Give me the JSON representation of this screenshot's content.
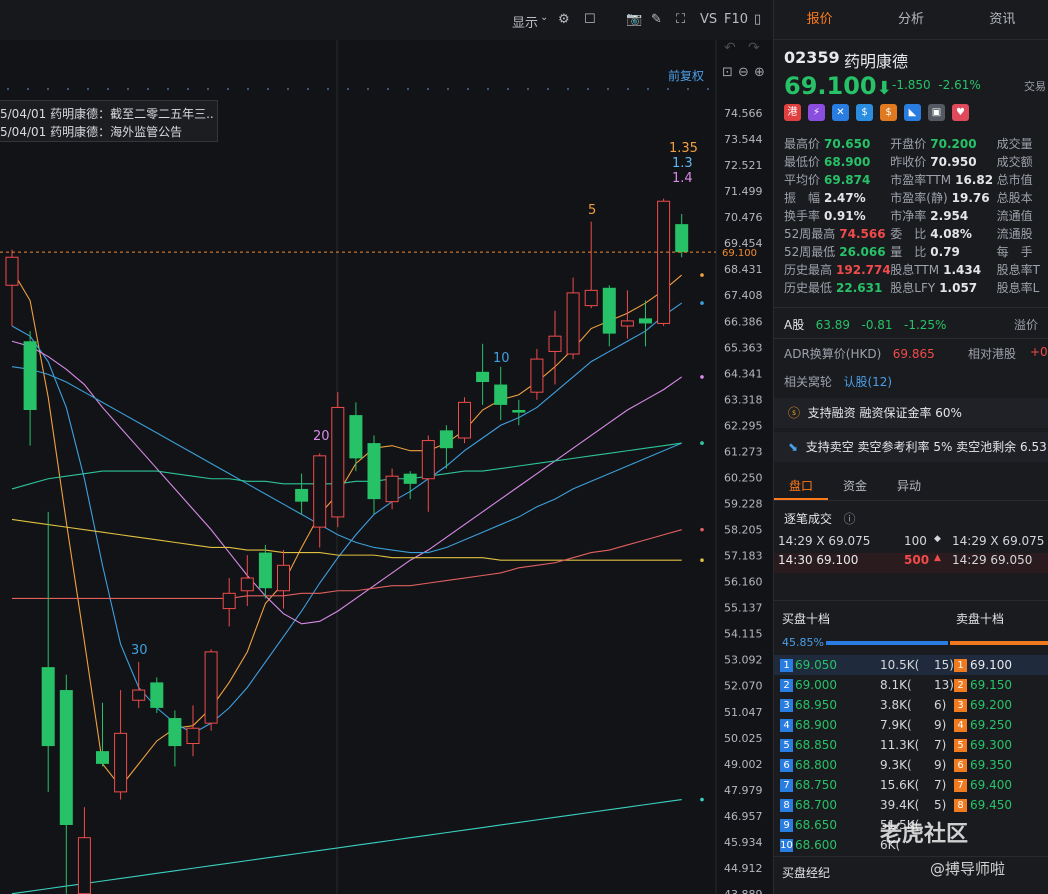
{
  "toolbar": {
    "display_label": "显示",
    "vs_label": "VS",
    "f10_label": "F10",
    "fuquan_label": "前复权"
  },
  "annotations": [
    "5/04/01  药明康德：截至二零二五年三...",
    "5/04/01  药明康德：海外监管公告"
  ],
  "chart_data": {
    "type": "candlestick",
    "y_ticks": [
      "74.566",
      "73.544",
      "72.521",
      "71.499",
      "70.476",
      "69.454",
      "68.431",
      "67.408",
      "66.386",
      "65.363",
      "64.341",
      "63.318",
      "62.295",
      "61.273",
      "60.250",
      "59.228",
      "58.205",
      "57.183",
      "56.160",
      "55.137",
      "54.115",
      "53.092",
      "52.070",
      "51.047",
      "50.025",
      "49.002",
      "47.979",
      "46.957",
      "45.934",
      "44.912",
      "43.889"
    ],
    "ylim": [
      43.889,
      74.566
    ],
    "current_price_label": "69.100",
    "ma_labels": [
      {
        "text": "30",
        "color": "#3fa0e0"
      },
      {
        "text": "20",
        "color": "#d98be8"
      },
      {
        "text": "10",
        "color": "#3fa0e0"
      },
      {
        "text": "5",
        "color": "#f0a040"
      },
      {
        "text": "1.35",
        "color": "#f0a040"
      },
      {
        "text": "1.3",
        "color": "#5fb8f0"
      },
      {
        "text": "1.4",
        "color": "#d98be8"
      }
    ],
    "candles": [
      {
        "o": 67.8,
        "c": 68.9,
        "h": 69.2,
        "l": 66.2
      },
      {
        "o": 65.6,
        "c": 62.9,
        "h": 66.0,
        "l": 61.5
      },
      {
        "o": 52.8,
        "c": 49.7,
        "h": 58.9,
        "l": 47.9
      },
      {
        "o": 51.9,
        "c": 46.6,
        "h": 52.5,
        "l": 43.9
      },
      {
        "o": 43.9,
        "c": 46.1,
        "h": 47.3,
        "l": 43.9
      },
      {
        "o": 49.5,
        "c": 49.0,
        "h": 51.4,
        "l": 48.9
      },
      {
        "o": 47.9,
        "c": 50.2,
        "h": 51.9,
        "l": 47.6
      },
      {
        "o": 51.5,
        "c": 51.9,
        "h": 53.0,
        "l": 51.2
      },
      {
        "o": 52.2,
        "c": 51.2,
        "h": 52.4,
        "l": 51.0
      },
      {
        "o": 50.8,
        "c": 49.7,
        "h": 51.1,
        "l": 48.9
      },
      {
        "o": 49.8,
        "c": 50.4,
        "h": 51.3,
        "l": 49.3
      },
      {
        "o": 50.6,
        "c": 53.4,
        "h": 53.5,
        "l": 50.3
      },
      {
        "o": 55.1,
        "c": 55.7,
        "h": 56.3,
        "l": 54.4
      },
      {
        "o": 55.8,
        "c": 56.3,
        "h": 57.2,
        "l": 55.2
      },
      {
        "o": 57.3,
        "c": 55.9,
        "h": 57.6,
        "l": 55.5
      },
      {
        "o": 55.8,
        "c": 56.8,
        "h": 57.4,
        "l": 55.1
      },
      {
        "o": 59.8,
        "c": 59.3,
        "h": 60.4,
        "l": 58.8
      },
      {
        "o": 58.3,
        "c": 61.1,
        "h": 61.2,
        "l": 57.5
      },
      {
        "o": 58.7,
        "c": 63.0,
        "h": 63.6,
        "l": 58.3
      },
      {
        "o": 62.7,
        "c": 61.0,
        "h": 63.2,
        "l": 60.5
      },
      {
        "o": 61.6,
        "c": 59.4,
        "h": 61.9,
        "l": 58.8
      },
      {
        "o": 59.3,
        "c": 60.3,
        "h": 60.6,
        "l": 59.0
      },
      {
        "o": 60.4,
        "c": 60.0,
        "h": 60.5,
        "l": 59.4
      },
      {
        "o": 60.2,
        "c": 61.7,
        "h": 61.9,
        "l": 58.9
      },
      {
        "o": 62.1,
        "c": 61.4,
        "h": 62.3,
        "l": 60.6
      },
      {
        "o": 61.8,
        "c": 63.2,
        "h": 63.4,
        "l": 61.6
      },
      {
        "o": 64.4,
        "c": 64.0,
        "h": 65.5,
        "l": 63.1
      },
      {
        "o": 63.9,
        "c": 63.1,
        "h": 64.6,
        "l": 62.5
      },
      {
        "o": 62.9,
        "c": 62.8,
        "h": 63.3,
        "l": 62.3
      },
      {
        "o": 63.6,
        "c": 64.9,
        "h": 65.3,
        "l": 63.3
      },
      {
        "o": 65.2,
        "c": 65.8,
        "h": 66.8,
        "l": 63.9
      },
      {
        "o": 65.1,
        "c": 67.5,
        "h": 68.1,
        "l": 64.9
      },
      {
        "o": 67.0,
        "c": 67.6,
        "h": 70.3,
        "l": 66.9
      },
      {
        "o": 67.7,
        "c": 65.9,
        "h": 67.8,
        "l": 65.4
      },
      {
        "o": 66.2,
        "c": 66.4,
        "h": 67.6,
        "l": 65.7
      },
      {
        "o": 66.5,
        "c": 66.3,
        "h": 67.2,
        "l": 65.4
      },
      {
        "o": 66.3,
        "c": 71.1,
        "h": 71.2,
        "l": 66.2
      },
      {
        "o": 70.2,
        "c": 69.1,
        "h": 70.6,
        "l": 68.9
      }
    ],
    "ma_series": [
      {
        "color": "#f0a040",
        "values": [
          68.4,
          67.2,
          63.4,
          58.5,
          53.8,
          49.0,
          48.1,
          49.0,
          49.9,
          50.4,
          50.5,
          51.2,
          52.2,
          53.4,
          55.3,
          56.1,
          57.5,
          58.8,
          59.6,
          60.8,
          61.4,
          61.5,
          61.3,
          61.3,
          61.6,
          62.1,
          62.9,
          63.3,
          63.5,
          64.0,
          64.6,
          65.3,
          66.1,
          66.4,
          66.7,
          67.1,
          67.6,
          68.2
        ]
      },
      {
        "color": "#3fa0e0",
        "values": [
          66.2,
          65.8,
          64.8,
          63.0,
          60.2,
          56.8,
          53.7,
          52.0,
          51.2,
          50.6,
          50.2,
          50.6,
          51.2,
          52.0,
          53.0,
          54.0,
          55.0,
          56.1,
          57.1,
          58.0,
          58.8,
          59.3,
          59.7,
          60.2,
          60.7,
          61.3,
          61.8,
          62.3,
          62.6,
          63.0,
          63.6,
          64.2,
          64.8,
          65.2,
          65.6,
          66.0,
          66.6,
          67.1
        ]
      },
      {
        "color": "#d98be8",
        "values": [
          65.6,
          65.4,
          65.0,
          64.5,
          63.9,
          63.0,
          62.2,
          61.4,
          60.6,
          59.8,
          59.0,
          58.2,
          57.3,
          56.4,
          55.6,
          54.9,
          54.5,
          54.6,
          55.0,
          55.5,
          56.0,
          56.5,
          57.0,
          57.4,
          57.9,
          58.4,
          58.9,
          59.4,
          59.9,
          60.4,
          60.9,
          61.4,
          61.9,
          62.4,
          62.9,
          63.3,
          63.7,
          64.2
        ]
      },
      {
        "color": "#3a9fd8",
        "values": [
          64.6,
          64.5,
          64.3,
          64.0,
          63.6,
          63.2,
          62.8,
          62.4,
          62.0,
          61.6,
          61.2,
          60.8,
          60.4,
          60.0,
          59.6,
          59.2,
          58.8,
          58.4,
          58.0,
          57.7,
          57.5,
          57.4,
          57.3,
          57.3,
          57.5,
          57.8,
          58.1,
          58.4,
          58.7,
          59.1,
          59.4,
          59.8,
          60.1,
          60.4,
          60.7,
          61.0,
          61.3,
          61.6
        ]
      },
      {
        "color": "#2ec39a",
        "values": [
          59.8,
          60.0,
          60.2,
          60.3,
          60.4,
          60.5,
          60.5,
          60.5,
          60.5,
          60.4,
          60.3,
          60.2,
          60.2,
          60.1,
          60.1,
          60.0,
          60.0,
          60.0,
          60.0,
          60.1,
          60.1,
          60.2,
          60.2,
          60.3,
          60.4,
          60.5,
          60.5,
          60.6,
          60.7,
          60.8,
          60.9,
          61.0,
          61.1,
          61.2,
          61.3,
          61.4,
          61.5,
          61.6
        ]
      },
      {
        "color": "#e0c040",
        "values": [
          58.6,
          58.5,
          58.4,
          58.3,
          58.2,
          58.1,
          58.0,
          57.9,
          57.8,
          57.7,
          57.6,
          57.5,
          57.5,
          57.4,
          57.4,
          57.3,
          57.3,
          57.3,
          57.2,
          57.2,
          57.2,
          57.1,
          57.1,
          57.1,
          57.1,
          57.1,
          57.1,
          57.0,
          57.0,
          57.0,
          57.0,
          57.0,
          57.0,
          57.0,
          57.0,
          57.0,
          57.0,
          57.0
        ]
      },
      {
        "color": "#e06060",
        "values": [
          55.5,
          55.5,
          55.5,
          55.5,
          55.5,
          55.5,
          55.5,
          55.5,
          55.5,
          55.5,
          55.5,
          55.5,
          55.5,
          55.6,
          55.6,
          55.6,
          55.7,
          55.7,
          55.8,
          55.8,
          55.9,
          56.0,
          56.0,
          56.1,
          56.2,
          56.3,
          56.4,
          56.5,
          56.7,
          56.8,
          56.9,
          57.1,
          57.3,
          57.4,
          57.6,
          57.8,
          58.0,
          58.2
        ]
      },
      {
        "color": "#3ad0c0",
        "values": [
          43.9,
          44.0,
          44.1,
          44.2,
          44.3,
          44.4,
          44.5,
          44.6,
          44.7,
          44.8,
          44.9,
          45.0,
          45.1,
          45.2,
          45.3,
          45.4,
          45.5,
          45.6,
          45.7,
          45.8,
          45.9,
          46.0,
          46.1,
          46.2,
          46.3,
          46.4,
          46.5,
          46.6,
          46.7,
          46.8,
          46.9,
          47.0,
          47.1,
          47.2,
          47.3,
          47.4,
          47.5,
          47.6
        ]
      }
    ]
  },
  "right": {
    "tabs": [
      "报价",
      "分析",
      "资讯"
    ],
    "code": "02359",
    "name": "药明康德",
    "price": "69.100",
    "arrow": "⬇",
    "change": "-1.850",
    "change_pct": "-2.61%",
    "jiaoyi": "交易",
    "badges": [
      {
        "t": "港",
        "c": "#e04040"
      },
      {
        "t": "⚡",
        "c": "#8a4de0"
      },
      {
        "t": "✕",
        "c": "#2a7de0"
      },
      {
        "t": "$",
        "c": "#2a8de0"
      },
      {
        "t": "$",
        "c": "#e07a20"
      },
      {
        "t": "◣",
        "c": "#2a7de0"
      },
      {
        "t": "▣",
        "c": "#555a62"
      },
      {
        "t": "♥",
        "c": "#e04a5a"
      }
    ],
    "stats": [
      [
        {
          "l": "最高价",
          "v": "70.650",
          "c": "down"
        },
        {
          "l": "开盘价",
          "v": "70.200",
          "c": "down"
        },
        {
          "l": "成交量",
          "v": ""
        }
      ],
      [
        {
          "l": "最低价",
          "v": "68.900",
          "c": "down"
        },
        {
          "l": "昨收价",
          "v": "70.950",
          "c": "w"
        },
        {
          "l": "成交额",
          "v": ""
        }
      ],
      [
        {
          "l": "平均价",
          "v": "69.874",
          "c": "down"
        },
        {
          "l": "市盈率TTM",
          "v": "16.82",
          "c": "w"
        },
        {
          "l": "总市值",
          "v": ""
        }
      ],
      [
        {
          "l": "振　幅",
          "v": "2.47%",
          "c": "w"
        },
        {
          "l": "市盈率(静)",
          "v": "19.76",
          "c": "w"
        },
        {
          "l": "总股本",
          "v": ""
        }
      ],
      [
        {
          "l": "换手率",
          "v": "0.91%",
          "c": "w"
        },
        {
          "l": "市净率",
          "v": "2.954",
          "c": "w"
        },
        {
          "l": "流通值",
          "v": ""
        }
      ],
      [
        {
          "l": "52周最高",
          "v": "74.566",
          "c": "up"
        },
        {
          "l": "委　比",
          "v": "4.08%",
          "c": "w"
        },
        {
          "l": "流通股",
          "v": ""
        }
      ],
      [
        {
          "l": "52周最低",
          "v": "26.066",
          "c": "down"
        },
        {
          "l": "量　比",
          "v": "0.79",
          "c": "w"
        },
        {
          "l": "每　手",
          "v": ""
        }
      ],
      [
        {
          "l": "历史最高",
          "v": "192.774",
          "c": "up"
        },
        {
          "l": "股息TTM",
          "v": "1.434",
          "c": "w"
        },
        {
          "l": "股息率T",
          "v": ""
        }
      ],
      [
        {
          "l": "历史最低",
          "v": "22.631",
          "c": "down"
        },
        {
          "l": "股息LFY",
          "v": "1.057",
          "c": "w"
        },
        {
          "l": "股息率L",
          "v": ""
        }
      ]
    ],
    "a_share": {
      "label": "A股",
      "price": "63.89",
      "chg": "-0.81",
      "pct": "-1.25%",
      "premium": "溢价"
    },
    "adr": {
      "label": "ADR换算价(HKD)",
      "value": "69.865",
      "rel": "相对港股",
      "rel_val": "+0."
    },
    "warrants": {
      "label": "相关窝轮",
      "value": "认股(12)"
    },
    "margin": "支持融资  融资保证金率 60%",
    "short": "支持卖空  卖空参考利率 5%  卖空池剩余 6.53",
    "subtabs": [
      "盘口",
      "资金",
      "异动"
    ],
    "ticks_title": "逐笔成交",
    "ticks": [
      {
        "left": "14:29 X  69.075",
        "vol": "100",
        "right": "14:29 X  69.075"
      },
      {
        "left": "14:30     69.100",
        "vol": "500",
        "right": "14:29     69.050"
      }
    ],
    "bid_title": "买盘十档",
    "ask_title": "卖盘十档",
    "bid_pct": "45.85%",
    "book": [
      {
        "b": "69.050",
        "bv": "10.5K(",
        "bc": "15)",
        "a": "69.100"
      },
      {
        "b": "69.000",
        "bv": "8.1K(",
        "bc": "13)",
        "a": "69.150"
      },
      {
        "b": "68.950",
        "bv": "3.8K(",
        "bc": "6)",
        "a": "69.200"
      },
      {
        "b": "68.900",
        "bv": "7.9K(",
        "bc": "9)",
        "a": "69.250"
      },
      {
        "b": "68.850",
        "bv": "11.3K(",
        "bc": "7)",
        "a": "69.300"
      },
      {
        "b": "68.800",
        "bv": "9.3K(",
        "bc": "9)",
        "a": "69.350"
      },
      {
        "b": "68.750",
        "bv": "15.6K(",
        "bc": "7)",
        "a": "69.400"
      },
      {
        "b": "68.700",
        "bv": "39.4K(",
        "bc": "5)",
        "a": "69.450"
      },
      {
        "b": "68.650",
        "bv": "51.5K(",
        "bc": "",
        "a": ""
      },
      {
        "b": "68.600",
        "bv": "6K(",
        "bc": "",
        "a": ""
      }
    ],
    "broker_title": "买盘经纪",
    "watermark": "老虎社区",
    "watermark2": "@搏导师啦"
  }
}
